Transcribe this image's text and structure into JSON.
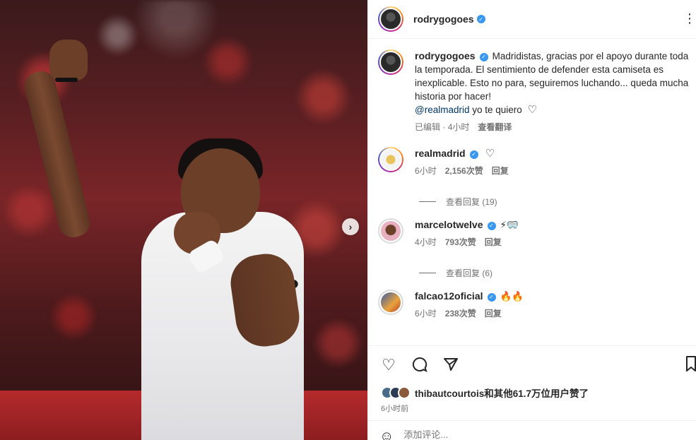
{
  "post": {
    "username": "rodrygogoes",
    "caption": "Madridistas, gracias por el apoyo durante toda la temporada. El sentimiento de defender esta camiseta es inexplicable. Esto no para, seguiremos luchando... queda mucha historia por hacer!",
    "mention": "@realmadrid",
    "caption_tail": " yo te quiero",
    "edited_label": "已编辑",
    "time": "4小时",
    "translate_label": "查看翻译"
  },
  "comments": [
    {
      "username": "realmadrid",
      "text": "",
      "emoji": "♡",
      "time": "6小时",
      "likes": "2,156次赞",
      "reply_label": "回复",
      "view_replies": "查看回复 (19)"
    },
    {
      "username": "marcelotwelve",
      "text": "",
      "emoji": "⚡🥽",
      "time": "4小时",
      "likes": "793次赞",
      "reply_label": "回复",
      "view_replies": "查看回复 (6)"
    },
    {
      "username": "falcao12oficial",
      "text": "",
      "emoji": "🔥🔥",
      "time": "6小时",
      "likes": "238次赞",
      "reply_label": "回复"
    }
  ],
  "actions": {
    "like_icon": "heart-outline",
    "comment_icon": "speech-bubble",
    "share_icon": "paper-plane",
    "likes_text": "thibautcourtois和其他61.7万位用户赞了",
    "time_ago": "6小时前",
    "comment_placeholder": "添加评论..."
  },
  "colors": {
    "verified": "#3897f0",
    "mention": "#00376b",
    "muted": "#737373"
  }
}
